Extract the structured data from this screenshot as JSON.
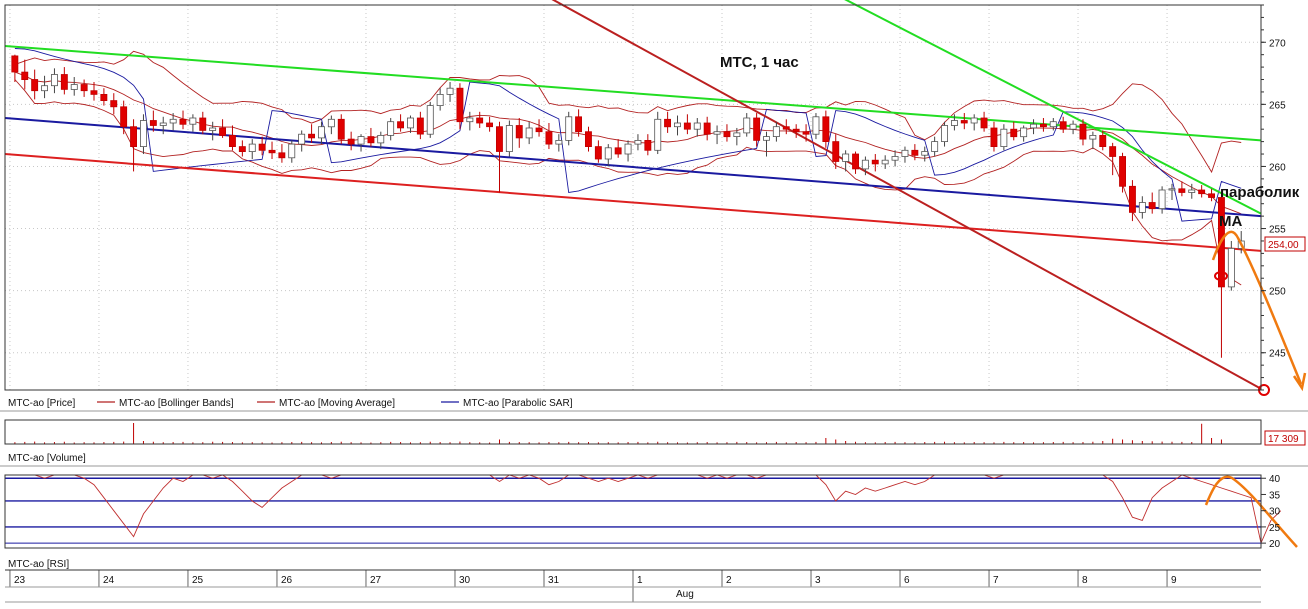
{
  "chart_data": {
    "type": "candlestick",
    "title": "МТС, 1 час",
    "annotations": {
      "parabolic": "параболик",
      "ma": "МА"
    },
    "price_axis": {
      "ylim": [
        242,
        273
      ],
      "ticks": [
        245,
        250,
        255,
        260,
        265,
        270
      ],
      "last_price_label": "254,00"
    },
    "volume": {
      "last_value_label": "17 309"
    },
    "rsi": {
      "ylim": [
        18.5,
        41
      ],
      "ticks": [
        20,
        25,
        30,
        35,
        40
      ]
    },
    "legend": [
      {
        "name": "MTC-ao [Price]",
        "color": "#000000"
      },
      {
        "name": "MTC-ao [Bollinger Bands]",
        "color": "#b22222"
      },
      {
        "name": "MTC-ao [Moving Average]",
        "color": "#b22222"
      },
      {
        "name": "MTC-ao [Parabolic SAR]",
        "color": "#1a1aa0"
      }
    ],
    "panel_labels": {
      "volume": "MTC-ao [Volume]",
      "rsi": "MTC-ao [RSI]"
    },
    "x_axis": {
      "days": [
        "23",
        "24",
        "25",
        "26",
        "27",
        "30",
        "31",
        "1",
        "2",
        "3",
        "6",
        "7",
        "8",
        "9"
      ],
      "month_label": "Aug"
    },
    "candles_per_day": 9,
    "candles": [
      [
        268.9,
        269.0,
        266.8,
        267.6
      ],
      [
        267.6,
        268.6,
        266.2,
        267.0
      ],
      [
        267.0,
        267.8,
        265.4,
        266.1
      ],
      [
        266.1,
        267.3,
        265.5,
        266.5
      ],
      [
        266.5,
        267.9,
        265.9,
        267.4
      ],
      [
        267.4,
        268.0,
        265.8,
        266.2
      ],
      [
        266.2,
        267.2,
        265.7,
        266.6
      ],
      [
        266.6,
        267.0,
        265.6,
        266.1
      ],
      [
        266.1,
        266.8,
        265.3,
        265.8
      ],
      [
        265.8,
        266.3,
        264.9,
        265.3
      ],
      [
        265.3,
        265.9,
        264.2,
        264.8
      ],
      [
        264.8,
        265.3,
        262.6,
        263.2
      ],
      [
        263.2,
        263.8,
        259.6,
        261.6
      ],
      [
        261.6,
        264.2,
        261.0,
        263.7
      ],
      [
        263.7,
        264.5,
        262.8,
        263.3
      ],
      [
        263.3,
        264.0,
        262.6,
        263.5
      ],
      [
        263.5,
        264.3,
        262.9,
        263.8
      ],
      [
        263.8,
        264.5,
        263.0,
        263.4
      ],
      [
        263.4,
        264.2,
        262.8,
        263.9
      ],
      [
        263.9,
        264.4,
        262.6,
        262.9
      ],
      [
        262.9,
        263.6,
        262.1,
        263.1
      ],
      [
        263.1,
        263.8,
        262.3,
        262.5
      ],
      [
        262.5,
        263.3,
        261.3,
        261.6
      ],
      [
        261.6,
        262.1,
        260.8,
        261.2
      ],
      [
        261.2,
        262.2,
        260.6,
        261.8
      ],
      [
        261.8,
        262.4,
        260.9,
        261.3
      ],
      [
        261.3,
        262.0,
        260.6,
        261.1
      ],
      [
        261.1,
        261.8,
        260.3,
        260.7
      ],
      [
        260.7,
        262.1,
        260.3,
        261.8
      ],
      [
        261.8,
        262.9,
        261.2,
        262.6
      ],
      [
        262.6,
        263.4,
        261.9,
        262.3
      ],
      [
        262.3,
        263.6,
        261.8,
        263.2
      ],
      [
        263.2,
        264.1,
        262.6,
        263.8
      ],
      [
        263.8,
        264.2,
        261.8,
        262.2
      ],
      [
        262.2,
        262.8,
        261.3,
        261.8
      ],
      [
        261.8,
        262.6,
        261.2,
        262.4
      ],
      [
        262.4,
        263.1,
        261.6,
        261.9
      ],
      [
        261.9,
        262.8,
        261.4,
        262.5
      ],
      [
        262.5,
        263.9,
        262.1,
        263.6
      ],
      [
        263.6,
        264.2,
        262.8,
        263.1
      ],
      [
        263.1,
        264.1,
        262.7,
        263.9
      ],
      [
        263.9,
        264.4,
        262.2,
        262.6
      ],
      [
        262.6,
        265.2,
        262.3,
        264.9
      ],
      [
        264.9,
        266.3,
        264.5,
        265.8
      ],
      [
        265.8,
        266.8,
        265.2,
        266.3
      ],
      [
        266.3,
        266.7,
        263.0,
        263.6
      ],
      [
        263.6,
        264.4,
        262.9,
        263.9
      ],
      [
        263.9,
        264.4,
        263.1,
        263.5
      ],
      [
        263.5,
        264.0,
        262.8,
        263.2
      ],
      [
        263.2,
        263.6,
        257.9,
        261.2
      ],
      [
        261.2,
        263.7,
        260.8,
        263.3
      ],
      [
        263.3,
        263.9,
        261.5,
        262.3
      ],
      [
        262.3,
        263.6,
        261.8,
        263.1
      ],
      [
        263.1,
        263.8,
        262.4,
        262.8
      ],
      [
        262.8,
        263.5,
        261.4,
        261.8
      ],
      [
        261.8,
        262.6,
        261.2,
        262.1
      ],
      [
        262.1,
        264.4,
        261.7,
        264.0
      ],
      [
        264.0,
        264.6,
        262.4,
        262.8
      ],
      [
        262.8,
        263.2,
        261.2,
        261.6
      ],
      [
        261.6,
        262.1,
        260.3,
        260.6
      ],
      [
        260.6,
        261.8,
        260.0,
        261.5
      ],
      [
        261.5,
        262.2,
        260.7,
        261.0
      ],
      [
        261.0,
        262.1,
        260.4,
        261.8
      ],
      [
        261.8,
        262.6,
        261.3,
        262.1
      ],
      [
        262.1,
        262.6,
        260.9,
        261.3
      ],
      [
        261.3,
        264.4,
        261.0,
        263.8
      ],
      [
        263.8,
        264.4,
        262.7,
        263.2
      ],
      [
        263.2,
        264.1,
        262.5,
        263.5
      ],
      [
        263.5,
        264.2,
        262.6,
        263.0
      ],
      [
        263.0,
        263.9,
        262.4,
        263.5
      ],
      [
        263.5,
        264.0,
        262.1,
        262.6
      ],
      [
        262.6,
        263.3,
        261.8,
        262.8
      ],
      [
        262.8,
        263.4,
        262.0,
        262.4
      ],
      [
        262.4,
        263.1,
        261.7,
        262.7
      ],
      [
        262.7,
        264.3,
        262.4,
        263.9
      ],
      [
        263.9,
        264.3,
        261.6,
        262.1
      ],
      [
        262.1,
        262.8,
        260.8,
        262.4
      ],
      [
        262.4,
        263.6,
        262.0,
        263.2
      ],
      [
        263.2,
        263.8,
        262.6,
        263.0
      ],
      [
        263.0,
        263.4,
        262.3,
        262.8
      ],
      [
        262.8,
        263.4,
        262.0,
        262.6
      ],
      [
        262.6,
        264.3,
        262.2,
        264.0
      ],
      [
        264.0,
        264.5,
        261.5,
        262.0
      ],
      [
        262.0,
        262.6,
        259.8,
        260.4
      ],
      [
        260.4,
        261.3,
        259.6,
        261.0
      ],
      [
        261.0,
        261.2,
        259.4,
        259.8
      ],
      [
        259.8,
        260.8,
        259.3,
        260.5
      ],
      [
        260.5,
        261.0,
        259.6,
        260.2
      ],
      [
        260.2,
        260.9,
        259.8,
        260.5
      ],
      [
        260.5,
        261.3,
        260.0,
        260.8
      ],
      [
        260.8,
        261.6,
        260.3,
        261.3
      ],
      [
        261.3,
        261.8,
        260.5,
        260.9
      ],
      [
        260.9,
        261.6,
        260.4,
        261.2
      ],
      [
        261.2,
        262.4,
        260.8,
        262.0
      ],
      [
        262.0,
        263.6,
        261.6,
        263.3
      ],
      [
        263.3,
        264.2,
        262.9,
        263.7
      ],
      [
        263.7,
        264.3,
        263.0,
        263.5
      ],
      [
        263.5,
        264.2,
        262.9,
        263.9
      ],
      [
        263.9,
        264.4,
        262.8,
        263.1
      ],
      [
        263.1,
        263.6,
        261.2,
        261.6
      ],
      [
        261.6,
        263.4,
        261.3,
        263.0
      ],
      [
        263.0,
        263.6,
        262.1,
        262.4
      ],
      [
        262.4,
        263.3,
        262.0,
        263.1
      ],
      [
        263.1,
        263.8,
        262.6,
        263.4
      ],
      [
        263.4,
        263.9,
        262.8,
        263.2
      ],
      [
        263.2,
        263.9,
        262.9,
        263.6
      ],
      [
        263.6,
        264.0,
        262.7,
        263.0
      ],
      [
        263.0,
        263.7,
        262.6,
        263.4
      ],
      [
        263.4,
        263.8,
        261.7,
        262.2
      ],
      [
        262.2,
        262.8,
        261.4,
        262.5
      ],
      [
        262.5,
        262.9,
        261.3,
        261.6
      ],
      [
        261.6,
        261.9,
        259.3,
        260.8
      ],
      [
        260.8,
        261.1,
        257.9,
        258.4
      ],
      [
        258.4,
        258.9,
        255.6,
        256.3
      ],
      [
        256.3,
        257.6,
        255.8,
        257.1
      ],
      [
        257.1,
        257.9,
        256.2,
        256.6
      ],
      [
        256.6,
        258.4,
        256.2,
        258.1
      ],
      [
        258.1,
        258.6,
        257.3,
        258.2
      ],
      [
        258.2,
        258.8,
        257.6,
        257.9
      ],
      [
        257.9,
        258.6,
        257.4,
        258.1
      ],
      [
        258.1,
        258.5,
        257.5,
        257.8
      ],
      [
        257.8,
        258.2,
        257.2,
        257.5
      ],
      [
        257.5,
        257.9,
        244.6,
        250.3
      ],
      [
        250.3,
        254.0,
        250.0,
        253.4
      ],
      [
        253.4,
        254.8,
        253.0,
        254.0
      ]
    ],
    "volume_values": [
      120,
      140,
      160,
      110,
      130,
      150,
      100,
      120,
      110,
      130,
      140,
      160,
      1400,
      200,
      150,
      120,
      130,
      140,
      110,
      120,
      150,
      140,
      130,
      110,
      120,
      110,
      100,
      120,
      130,
      140,
      120,
      110,
      130,
      150,
      120,
      110,
      100,
      120,
      140,
      130,
      110,
      120,
      150,
      130,
      120,
      160,
      120,
      110,
      100,
      300,
      140,
      130,
      120,
      110,
      130,
      120,
      140,
      120,
      130,
      110,
      120,
      110,
      130,
      140,
      110,
      150,
      120,
      110,
      100,
      120,
      130,
      110,
      120,
      140,
      130,
      110,
      120,
      140,
      110,
      130,
      120,
      140,
      400,
      300,
      200,
      150,
      120,
      110,
      130,
      140,
      120,
      110,
      130,
      140,
      150,
      120,
      110,
      130,
      120,
      110,
      140,
      120,
      130,
      110,
      120,
      130,
      140,
      120,
      130,
      150,
      200,
      350,
      300,
      250,
      200,
      180,
      160,
      150,
      140,
      130,
      1350,
      400,
      300
    ],
    "rsi_values": [
      42,
      44,
      41,
      40,
      45,
      43,
      42,
      40,
      38,
      34,
      30,
      26,
      22,
      29,
      33,
      37,
      40,
      39,
      42,
      41,
      40,
      41,
      39,
      36,
      33,
      31,
      34,
      37,
      39,
      41,
      42,
      41,
      40,
      42,
      41,
      43,
      44,
      45,
      47,
      46,
      45,
      44,
      49,
      51,
      50,
      45,
      44,
      43,
      41,
      39,
      42,
      40,
      41,
      40,
      38,
      39,
      42,
      41,
      40,
      39,
      40,
      39,
      40,
      41,
      40,
      43,
      42,
      42,
      41,
      41,
      40,
      41,
      40,
      41,
      43,
      40,
      41,
      42,
      42,
      41,
      41,
      43,
      38,
      33,
      36,
      35,
      37,
      36,
      37,
      38,
      39,
      38,
      39,
      41,
      43,
      44,
      43,
      44,
      42,
      40,
      42,
      41,
      42,
      42,
      42,
      43,
      42,
      43,
      41,
      42,
      41,
      39,
      34,
      28,
      27,
      34,
      37,
      39,
      41,
      40,
      39,
      38,
      37,
      36,
      35,
      34,
      20,
      27,
      30
    ],
    "trendlines": [
      {
        "color": "#22dd22",
        "x": [
          0,
          1.0
        ],
        "y": [
          269.7,
          262.1
        ]
      },
      {
        "color": "#22dd22",
        "x": [
          0.668,
          1.0
        ],
        "y": [
          273.5,
          256.2
        ]
      },
      {
        "color": "#1a1aa0",
        "x": [
          0,
          1.0
        ],
        "y": [
          263.9,
          256.0
        ]
      },
      {
        "color": "#dd2020",
        "x": [
          0,
          1.0
        ],
        "y": [
          261.0,
          253.2
        ]
      },
      {
        "color": "#bb2020",
        "x": [
          0.435,
          1.0
        ],
        "y": [
          273.5,
          242.1
        ]
      }
    ],
    "forecast_color": "#f07a10"
  }
}
